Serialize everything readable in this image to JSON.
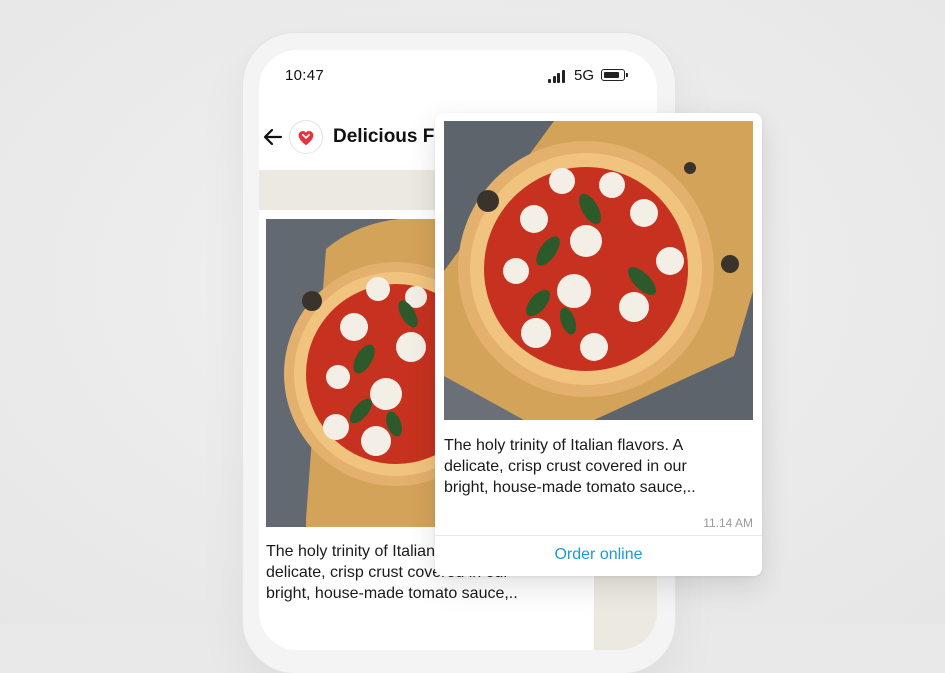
{
  "status_bar": {
    "time": "10:47",
    "network": "5G"
  },
  "header": {
    "business_name": "Delicious Foods"
  },
  "message": {
    "text_lines": [
      "The holy trinity of Italian flavors. A",
      "delicate, crisp crust covered in our",
      "bright, house-made tomato sauce,.."
    ],
    "timestamp": "11.14 AM",
    "cta_label": "Order online",
    "image_subject": "margherita-pizza"
  },
  "colors": {
    "cta": "#1a9bd7",
    "brand": "#e3343f"
  },
  "icons": {
    "back": "arrow-left-icon",
    "logo": "heart-logo-icon",
    "signal": "signal-icon",
    "battery": "battery-icon"
  }
}
